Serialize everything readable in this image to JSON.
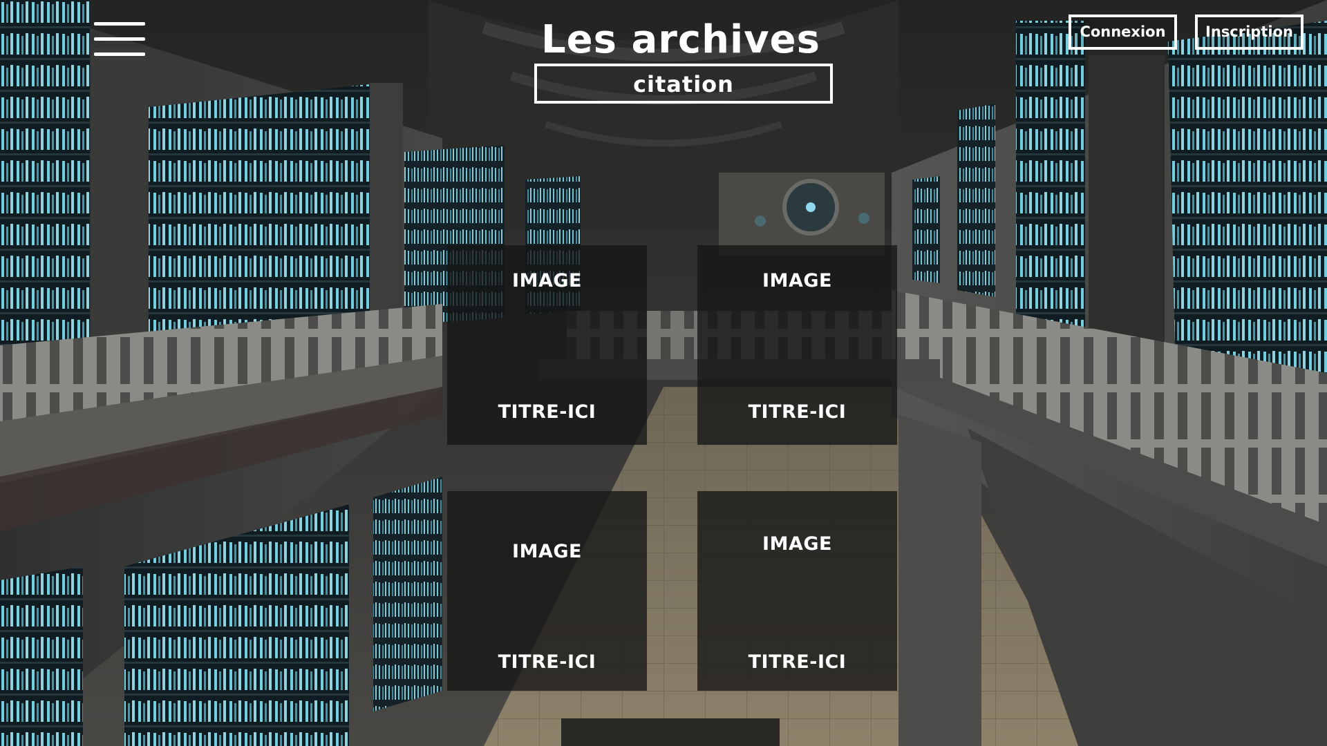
{
  "header": {
    "title": "Les archives",
    "quote": "citation",
    "menu_icon": "hamburger-menu-icon",
    "login_label": "Connexion",
    "signup_label": "Inscription"
  },
  "cards": [
    {
      "image_label": "IMAGE",
      "title": "TITRE-ICI"
    },
    {
      "image_label": "IMAGE",
      "title": "TITRE-ICI"
    },
    {
      "image_label": "IMAGE",
      "title": "TITRE-ICI"
    },
    {
      "image_label": "IMAGE",
      "title": "TITRE-ICI"
    }
  ],
  "colors": {
    "text": "#ffffff",
    "card_background": "#161616",
    "shelf_glow": "#7fe3f5",
    "hall_stone": "#3a3a38"
  }
}
